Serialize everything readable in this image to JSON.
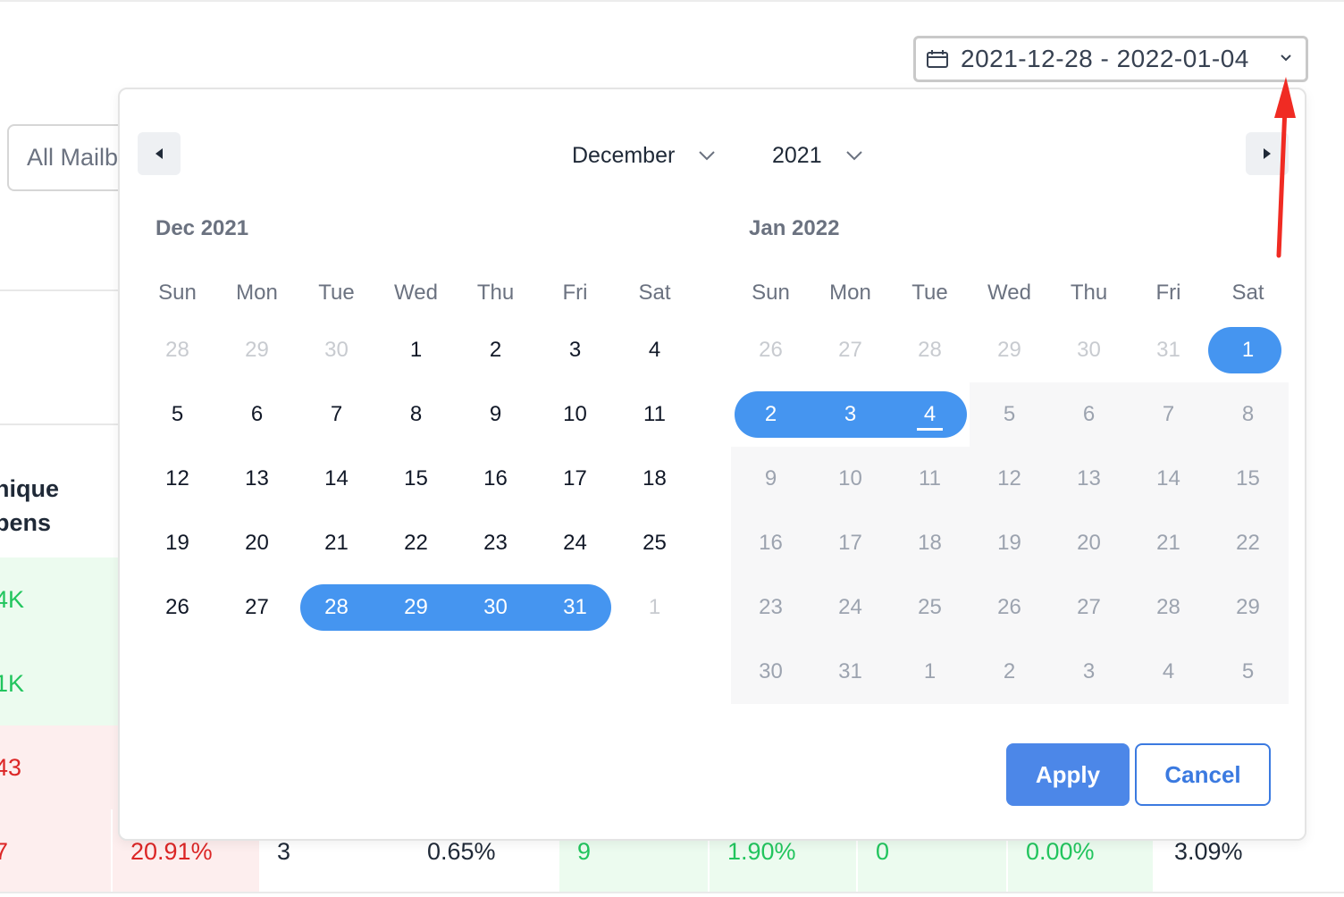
{
  "date_range": {
    "value": "2021-12-28 - 2022-01-04",
    "icon": "calendar-icon"
  },
  "mailbox_select": {
    "value": "All Mailb"
  },
  "background_table": {
    "header_lines": [
      "nique",
      "pens"
    ],
    "col1_values": [
      "4K",
      "1K",
      "43",
      "7"
    ],
    "bottom_row": [
      "20.91%",
      "3",
      "0.65%",
      "9",
      "1.90%",
      "0",
      "0.00%",
      "3.09%"
    ]
  },
  "picker": {
    "month_select": "December",
    "year_select": "2021",
    "weekdays": [
      "Sun",
      "Mon",
      "Tue",
      "Wed",
      "Thu",
      "Fri",
      "Sat"
    ],
    "left": {
      "title": "Dec 2021",
      "weeks": [
        [
          "28",
          "29",
          "30",
          "1",
          "2",
          "3",
          "4"
        ],
        [
          "5",
          "6",
          "7",
          "8",
          "9",
          "10",
          "11"
        ],
        [
          "12",
          "13",
          "14",
          "15",
          "16",
          "17",
          "18"
        ],
        [
          "19",
          "20",
          "21",
          "22",
          "23",
          "24",
          "25"
        ],
        [
          "26",
          "27",
          "28",
          "29",
          "30",
          "31",
          "1"
        ]
      ]
    },
    "right": {
      "title": "Jan 2022",
      "weeks": [
        [
          "26",
          "27",
          "28",
          "29",
          "30",
          "31",
          "1"
        ],
        [
          "2",
          "3",
          "4",
          "5",
          "6",
          "7",
          "8"
        ],
        [
          "9",
          "10",
          "11",
          "12",
          "13",
          "14",
          "15"
        ],
        [
          "16",
          "17",
          "18",
          "19",
          "20",
          "21",
          "22"
        ],
        [
          "23",
          "24",
          "25",
          "26",
          "27",
          "28",
          "29"
        ],
        [
          "30",
          "31",
          "1",
          "2",
          "3",
          "4",
          "5"
        ]
      ]
    },
    "apply_label": "Apply",
    "cancel_label": "Cancel"
  },
  "colors": {
    "selected": "#4595f0",
    "apply": "#4c87e8",
    "cancel_border": "#3b7ae0",
    "annotation": "#f02b23"
  }
}
